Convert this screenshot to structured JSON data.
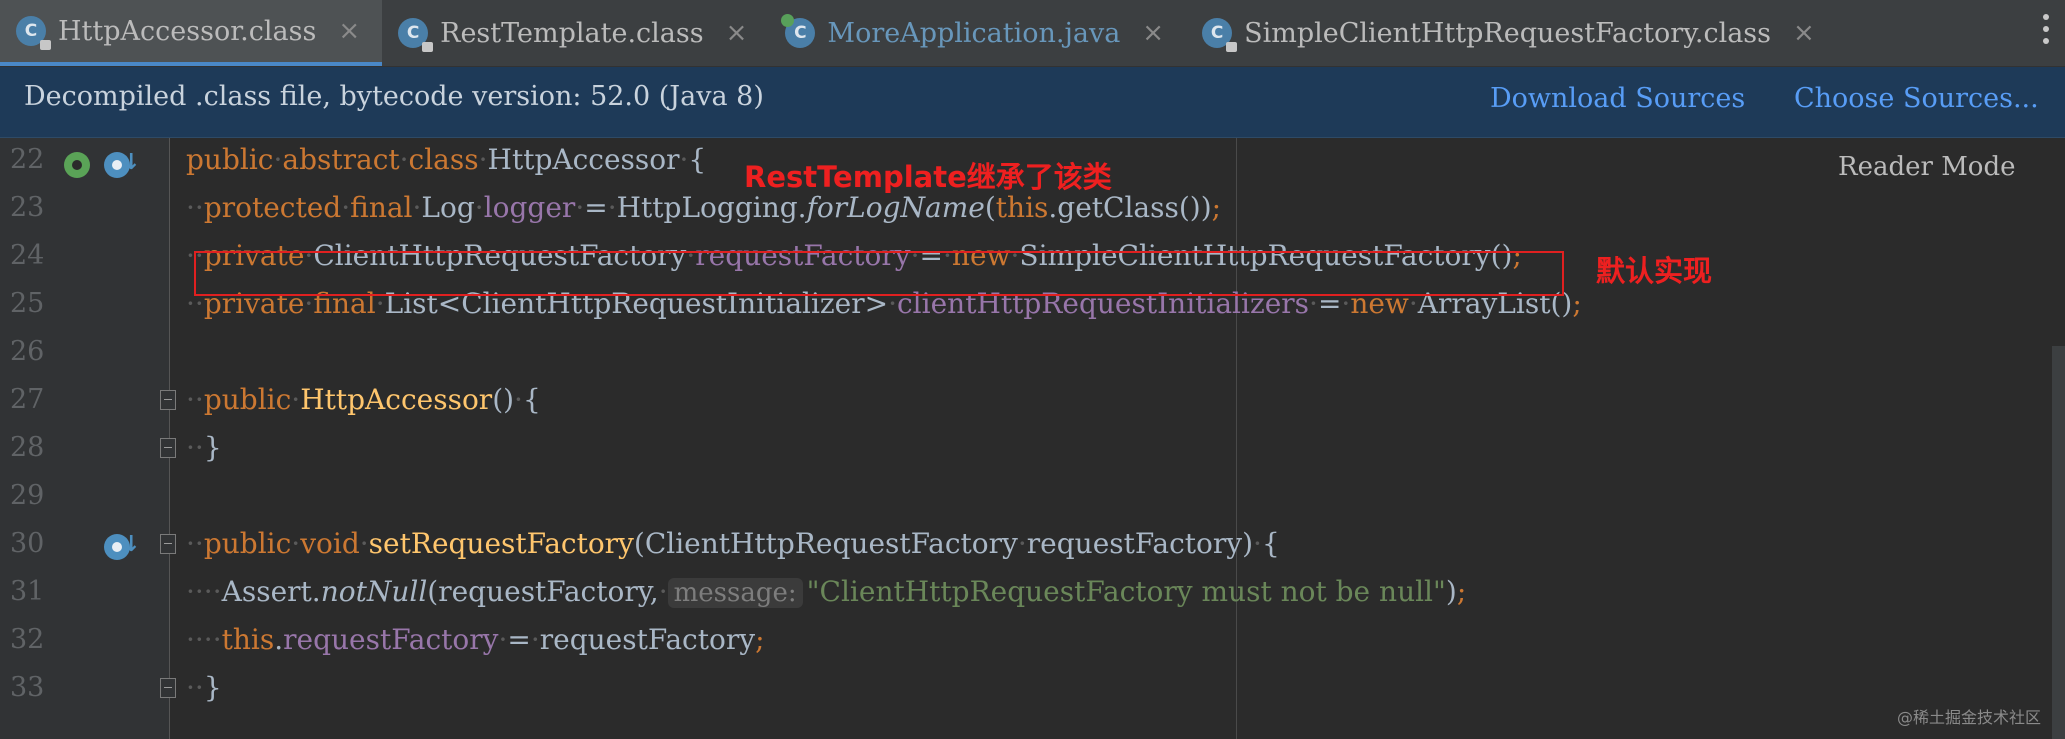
{
  "tabs": [
    {
      "label": "HttpAccessor.class",
      "icon": "class-file-icon",
      "active": true
    },
    {
      "label": "RestTemplate.class",
      "icon": "class-file-icon",
      "active": false
    },
    {
      "label": "MoreApplication.java",
      "icon": "spring-boot-class-icon",
      "active": false
    },
    {
      "label": "SimpleClientHttpRequestFactory.class",
      "icon": "class-file-icon",
      "active": false
    }
  ],
  "tab_close_glyph": "×",
  "banner": {
    "message": "Decompiled .class file, bytecode version: 52.0 (Java 8)",
    "download_sources": "Download Sources",
    "choose_sources": "Choose Sources..."
  },
  "editor": {
    "reader_mode": "Reader Mode",
    "line_numbers": [
      "22",
      "23",
      "24",
      "25",
      "26",
      "27",
      "28",
      "29",
      "30",
      "31",
      "32",
      "33"
    ],
    "param_hint": "message:",
    "string_literal": "\"ClientHttpRequestFactory must not be null\""
  },
  "annotations": {
    "class_note": "RestTemplate继承了该类",
    "field_note": "默认实现"
  },
  "watermark": "@稀土掘金技术社区",
  "colors": {
    "background": "#2b2b2b",
    "keyword": "#cc7832",
    "field": "#9876aa",
    "method": "#ffc66d",
    "string": "#6a8759",
    "link": "#589df6",
    "annotation_red": "#ee2020"
  }
}
